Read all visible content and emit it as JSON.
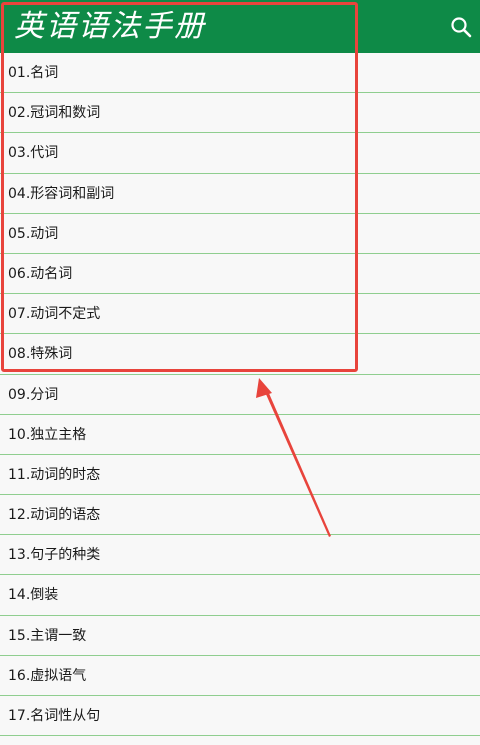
{
  "appbar": {
    "title": "英语语法手册",
    "search_icon": "search-icon",
    "background_color": "#0e8a47"
  },
  "list": {
    "items": [
      {
        "label": "01.名词"
      },
      {
        "label": "02.冠词和数词"
      },
      {
        "label": "03.代词"
      },
      {
        "label": "04.形容词和副词"
      },
      {
        "label": "05.动词"
      },
      {
        "label": "06.动名词"
      },
      {
        "label": "07.动词不定式"
      },
      {
        "label": "08.特殊词"
      },
      {
        "label": "09.分词"
      },
      {
        "label": "10.独立主格"
      },
      {
        "label": "11.动词的时态"
      },
      {
        "label": "12.动词的语态"
      },
      {
        "label": "13.句子的种类"
      },
      {
        "label": "14.倒装"
      },
      {
        "label": "15.主谓一致"
      },
      {
        "label": "16.虚拟语气"
      },
      {
        "label": "17.名词性从句"
      }
    ],
    "divider_color": "#8fce8f"
  },
  "annotation": {
    "highlight_color": "#e8443c"
  }
}
